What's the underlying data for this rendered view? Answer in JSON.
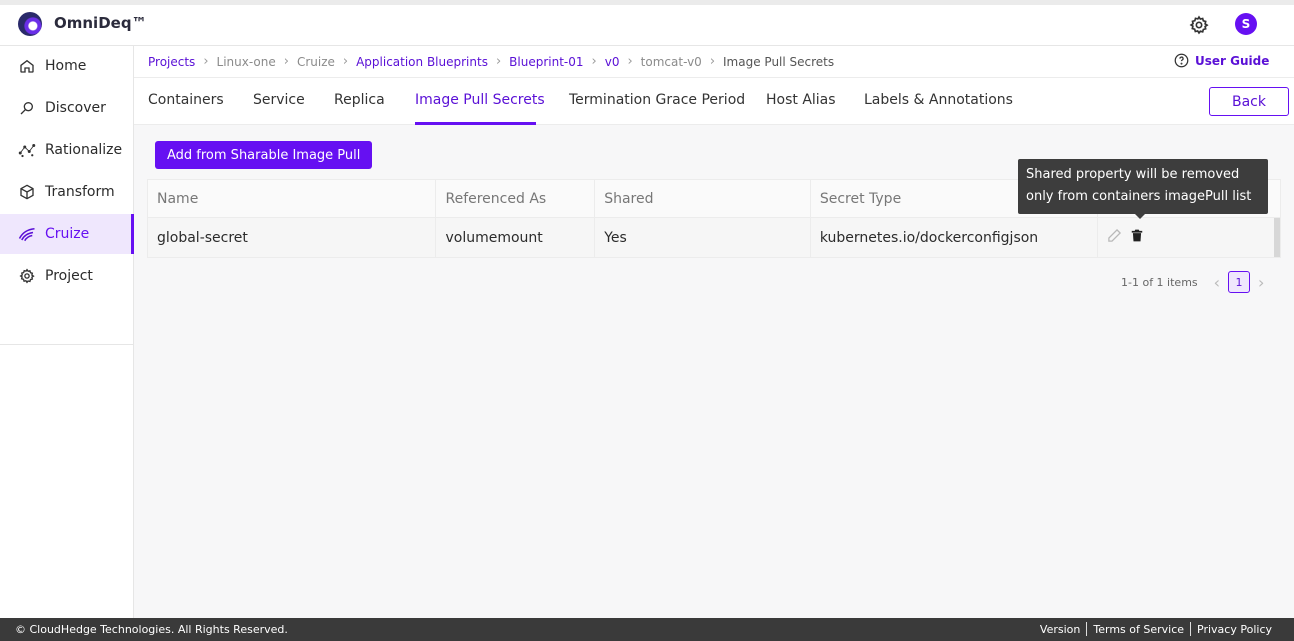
{
  "app": {
    "name": "OmniDeq™",
    "user_initial": "S"
  },
  "sidebar": {
    "items": [
      {
        "label": "Home",
        "icon": "home-icon"
      },
      {
        "label": "Discover",
        "icon": "discover-icon"
      },
      {
        "label": "Rationalize",
        "icon": "rationalize-icon"
      },
      {
        "label": "Transform",
        "icon": "transform-icon"
      },
      {
        "label": "Cruize",
        "icon": "cruize-icon",
        "active": true
      },
      {
        "label": "Project",
        "icon": "project-icon"
      }
    ]
  },
  "breadcrumb": {
    "items": [
      "Projects",
      "Linux-one",
      "Cruize",
      "Application Blueprints",
      "Blueprint-01",
      "v0",
      "tomcat-v0",
      "Image Pull Secrets"
    ],
    "user_guide": "User Guide"
  },
  "tabs": {
    "items": [
      "Containers",
      "Service",
      "Replica",
      "Image Pull Secrets",
      "Termination Grace Period",
      "Host Alias",
      "Labels & Annotations"
    ],
    "active": "Image Pull Secrets",
    "back_label": "Back"
  },
  "main": {
    "add_button": "Add from Sharable Image Pull",
    "table": {
      "headers": [
        "Name",
        "Referenced As",
        "Shared",
        "Secret Type",
        ""
      ],
      "rows": [
        {
          "name": "global-secret",
          "referenced_as": "volumemount",
          "shared": "Yes",
          "secret_type": "kubernetes.io/dockerconfigjson"
        }
      ]
    },
    "pagination": {
      "summary": "1-1 of 1 items",
      "current_page": "1"
    },
    "tooltip": {
      "line1": "Shared property will be removed",
      "line2": "only from containers imagePull list"
    }
  },
  "footer": {
    "copyright": "© CloudHedge Technologies. All Rights Reserved.",
    "links": [
      "Version",
      "Terms of Service",
      "Privacy Policy"
    ]
  },
  "colors": {
    "accent": "#6610f2",
    "footer_bg": "#3a3a3a",
    "tooltip_bg": "#3d3d3d"
  }
}
